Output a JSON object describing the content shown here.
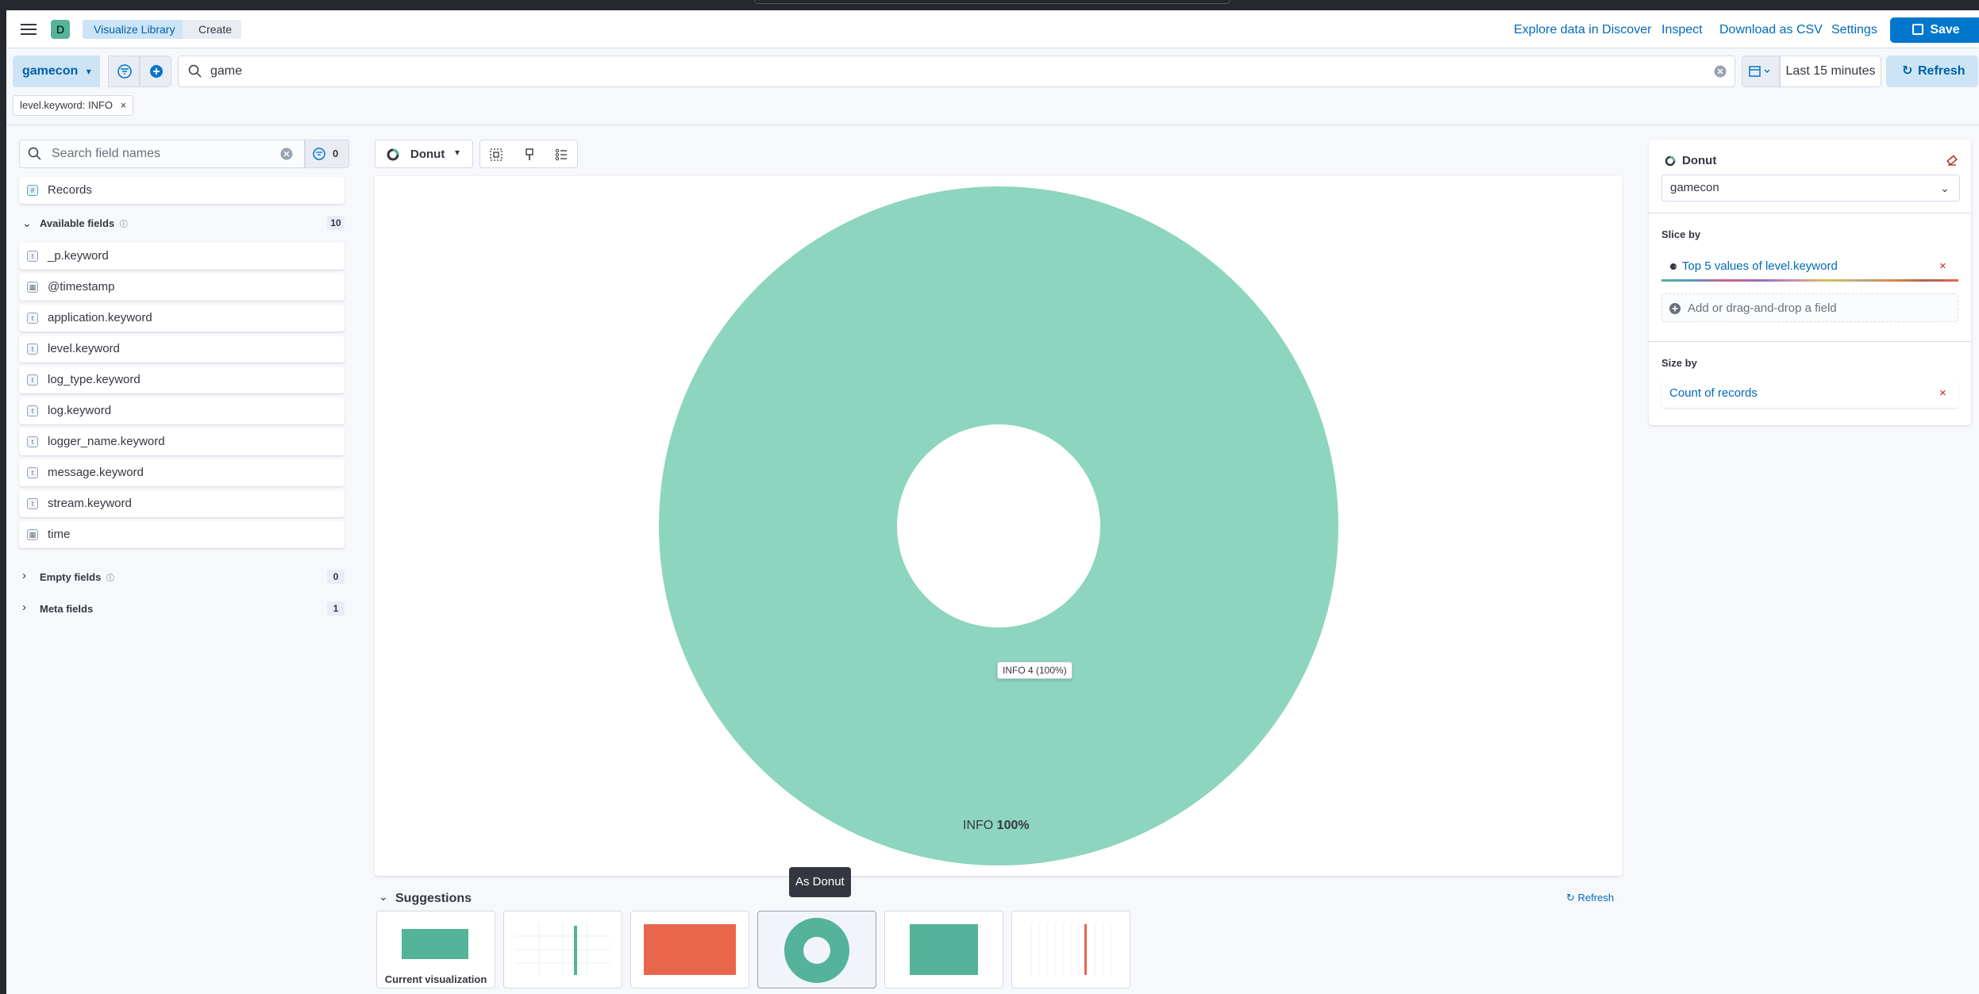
{
  "header": {
    "space_initial": "D",
    "breadcrumbs": [
      "Visualize Library",
      "Create"
    ],
    "links": [
      "Explore data in Discover",
      "Inspect",
      "Download as CSV",
      "Settings"
    ],
    "save_label": "Save"
  },
  "query_bar": {
    "data_view": "gamecon",
    "query": "game",
    "date_range": "Last 15 minutes",
    "refresh_label": "Refresh",
    "filter_pill": "level.keyword: INFO"
  },
  "fields_panel": {
    "search_placeholder": "Search field names",
    "filter_count": "0",
    "records_label": "Records",
    "available_title": "Available fields",
    "available_count": "10",
    "fields": [
      {
        "name": "_p.keyword",
        "type": "t"
      },
      {
        "name": "@timestamp",
        "type": "date"
      },
      {
        "name": "application.keyword",
        "type": "t"
      },
      {
        "name": "level.keyword",
        "type": "t"
      },
      {
        "name": "log_type.keyword",
        "type": "t"
      },
      {
        "name": "log.keyword",
        "type": "t"
      },
      {
        "name": "logger_name.keyword",
        "type": "t"
      },
      {
        "name": "message.keyword",
        "type": "t"
      },
      {
        "name": "stream.keyword",
        "type": "t"
      },
      {
        "name": "time",
        "type": "date"
      }
    ],
    "empty_title": "Empty fields",
    "empty_count": "0",
    "meta_title": "Meta fields",
    "meta_count": "1"
  },
  "chart_toolbar": {
    "chart_type_label": "Donut"
  },
  "chart_data": {
    "type": "pie",
    "slices": [
      {
        "label": "INFO",
        "value": 4,
        "percent": 100
      }
    ],
    "tooltip": "INFO  4 (100%)",
    "label_name": "INFO",
    "label_pct": "100%",
    "color": "#8dd5bf"
  },
  "config_panel": {
    "chart_type": "Donut",
    "data_view": "gamecon",
    "slice_by_title": "Slice by",
    "slice_by_value": "Top 5 values of level.keyword",
    "add_field": "Add or drag-and-drop a field",
    "size_by_title": "Size by",
    "size_by_value": "Count of records"
  },
  "suggestions": {
    "title": "Suggestions",
    "refresh_label": "Refresh",
    "current_label": "Current visualization",
    "tooltip": "As Donut"
  },
  "colors": {
    "accent": "#0077cc",
    "donut": "#8dd5bf",
    "suggestion_teal": "#54b399",
    "suggestion_red": "#e7664c"
  }
}
